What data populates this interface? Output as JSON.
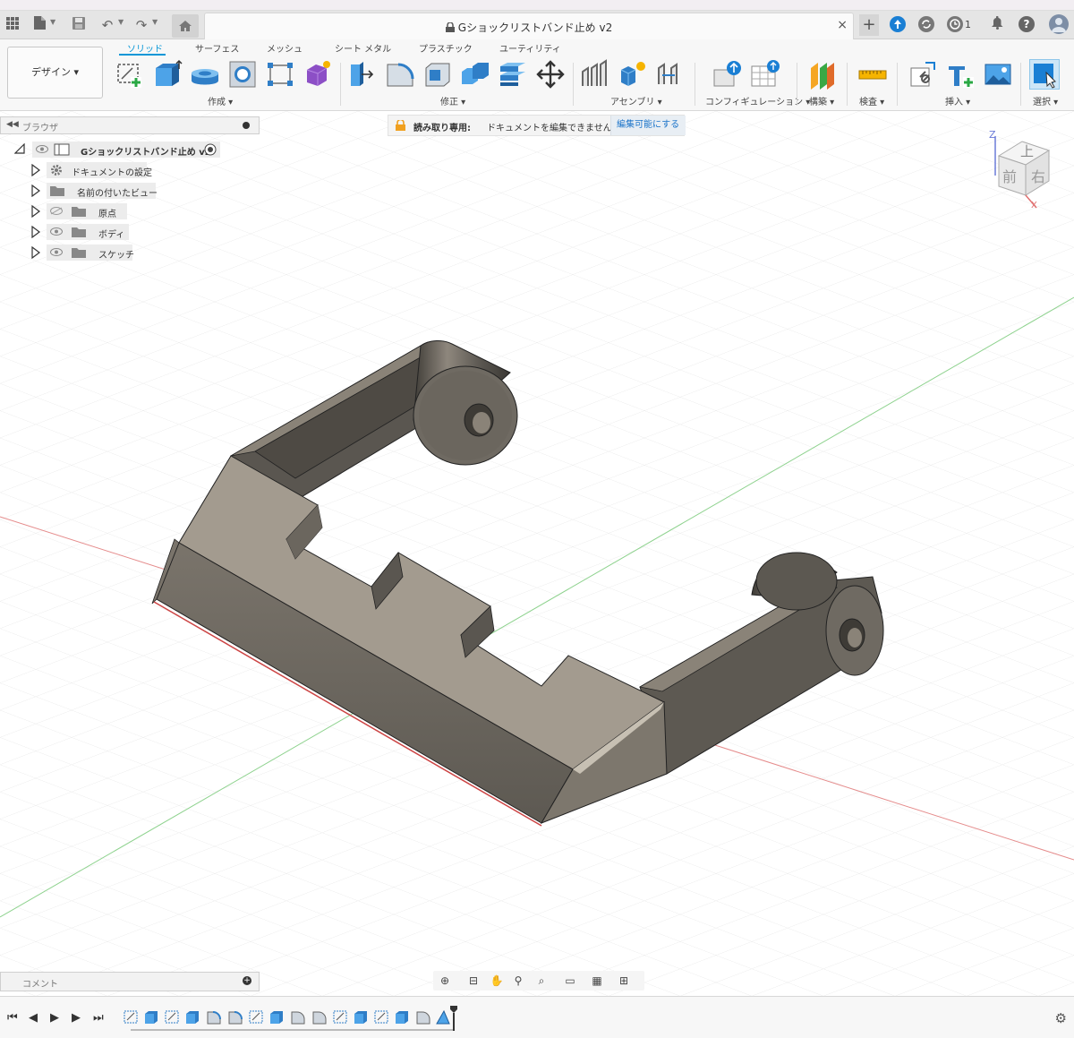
{
  "document_title": "Gショックリストバンド止め v2",
  "app_bar": {
    "grid_icon": "grid-icon",
    "file_icon": "file-icon",
    "save_icon": "save-icon",
    "undo_icon": "undo-icon",
    "redo_icon": "redo-icon",
    "home_icon": "home-icon",
    "close_tab": "×",
    "new_tab": "+",
    "job_count": "1"
  },
  "toolbar": {
    "workspace_label": "デザイン ▾",
    "tabs": [
      {
        "label": "ソリッド",
        "active": true
      },
      {
        "label": "サーフェス",
        "active": false
      },
      {
        "label": "メッシュ",
        "active": false
      },
      {
        "label": "シート メタル",
        "active": false
      },
      {
        "label": "プラスチック",
        "active": false
      },
      {
        "label": "ユーティリティ",
        "active": false
      }
    ],
    "groups": {
      "create": "作成 ▾",
      "modify": "修正 ▾",
      "assemble": "アセンブリ ▾",
      "configure": "コンフィギュレーション ▾",
      "construct": "構築 ▾",
      "inspect": "検査 ▾",
      "insert": "挿入 ▾",
      "select": "選択 ▾"
    }
  },
  "browser": {
    "title": "ブラウザ",
    "root": "Gショックリストバンド止め v2",
    "items": [
      {
        "label": "ドキュメントの設定",
        "icon": "gear-icon"
      },
      {
        "label": "名前の付いたビュー",
        "icon": "folder-icon"
      },
      {
        "label": "原点",
        "icon": "folder-icon",
        "visible": false
      },
      {
        "label": "ボディ",
        "icon": "folder-icon",
        "visible": true
      },
      {
        "label": "スケッチ",
        "icon": "folder-icon",
        "visible": true
      }
    ]
  },
  "banner": {
    "readonly": "読み取り専用:",
    "message": "ドキュメントを編集できません",
    "action": "編集可能にする"
  },
  "viewcube": {
    "top": "上",
    "front": "前",
    "right": "右",
    "axis_z": "Z",
    "axis_x": "X"
  },
  "comment": {
    "label": "コメント"
  },
  "colors": {
    "accent": "#0696d7",
    "model_top": "#a39b8f",
    "model_side": "#6b675f",
    "model_dark": "#504c46",
    "grid": "#e4e4e4"
  }
}
